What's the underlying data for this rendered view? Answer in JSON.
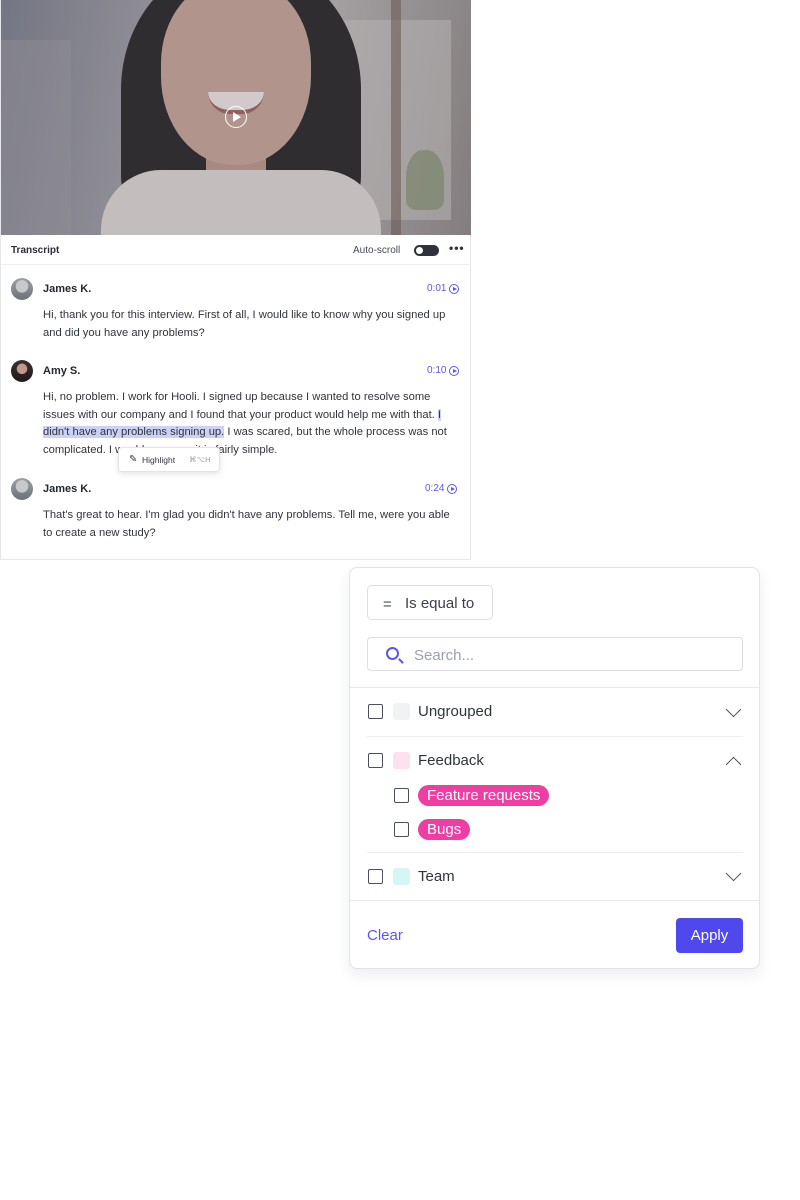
{
  "transcript": {
    "title": "Transcript",
    "autoscroll_label": "Auto-scroll",
    "autoscroll_on": false,
    "more_label": "•••",
    "entries": [
      {
        "speaker": "James K.",
        "avatar": "man-avatar",
        "time": "0:01",
        "text": "Hi, thank you for this interview. First of all, I would like to know why you signed up and did you have any problems?"
      },
      {
        "speaker": "Amy S.",
        "avatar": "woman-avatar",
        "time": "0:10",
        "text_before": "Hi, no problem. I work for Hooli. I signed up because I wanted to resolve some issues with our company and I found that your product would help me with that. ",
        "text_highlighted": "I didn't have any problems signing up.",
        "text_after": " I was scared, but the whole process was not complicated. I would even say it is fairly simple."
      },
      {
        "speaker": "James K.",
        "avatar": "man-avatar",
        "time": "0:24",
        "text": "That's great to hear. I'm glad you didn't have any problems. Tell me, were you able to create a new study?"
      }
    ],
    "highlight_tooltip": {
      "icon": "pen-icon",
      "label": "Highlight",
      "shortcut": "⌘⌥H"
    }
  },
  "video": {
    "play_icon": "play-circle-icon"
  },
  "filter": {
    "operator_icon": "equals-icon",
    "operator_label": "Is equal to",
    "search_placeholder": "Search...",
    "search_value": "",
    "groups": [
      {
        "label": "Ungrouped",
        "swatch_color": "#f1f2f4",
        "expanded": false,
        "checked": false
      },
      {
        "label": "Feedback",
        "swatch_color": "#fde1ef",
        "expanded": true,
        "checked": false,
        "tags": [
          {
            "label": "Feature requests",
            "color": "#ee3ea4",
            "checked": false
          },
          {
            "label": "Bugs",
            "color": "#ee3ea4",
            "checked": false
          }
        ]
      },
      {
        "label": "Team",
        "swatch_color": "#d6f5f5",
        "expanded": false,
        "checked": false
      }
    ],
    "clear_label": "Clear",
    "apply_label": "Apply",
    "accent_color": "#4f48ec"
  }
}
